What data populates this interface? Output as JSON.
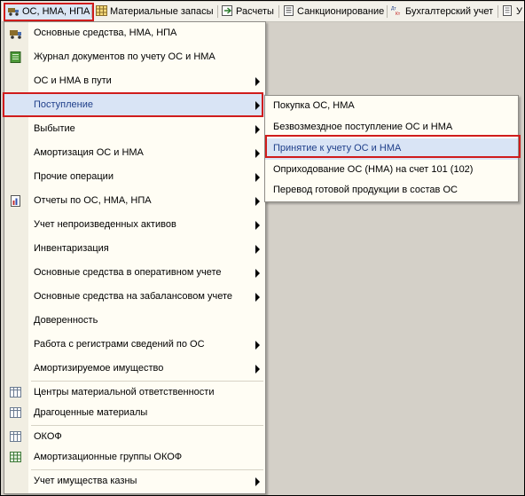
{
  "menubar": {
    "items": [
      {
        "label": "ОС, НМА, НПА",
        "icon": "truck-icon",
        "active": true
      },
      {
        "label": "Материальные запасы",
        "icon": "grid-icon"
      },
      {
        "label": "Расчеты",
        "icon": "calc-icon"
      },
      {
        "label": "Санкционирование",
        "icon": "doc-list-icon"
      },
      {
        "label": "Бухгалтерский учет",
        "icon": "dt-kt-icon"
      },
      {
        "label": "У",
        "icon": "report-icon"
      }
    ]
  },
  "main_menu": {
    "items": [
      {
        "label": "Основные средства, НМА, НПА",
        "icon": "truck-icon",
        "submenu": false
      },
      {
        "label": "Журнал документов по учету ОС и НМА",
        "icon": "journal-icon",
        "submenu": false
      },
      {
        "label": "ОС и НМА в пути",
        "submenu": true
      },
      {
        "label": "Поступление",
        "submenu": true,
        "highlighted": true
      },
      {
        "label": "Выбытие",
        "submenu": true
      },
      {
        "label": "Амортизация ОС и НМА",
        "submenu": true
      },
      {
        "label": "Прочие операции",
        "submenu": true
      },
      {
        "label": "Отчеты по ОС, НМА, НПА",
        "icon": "report-icon",
        "submenu": true
      },
      {
        "label": "Учет непроизведенных активов",
        "submenu": true
      },
      {
        "label": "Инвентаризация",
        "submenu": true
      },
      {
        "label": "Основные средства в оперативном учете",
        "submenu": true
      },
      {
        "label": "Основные средства на забалансовом учете",
        "submenu": true
      },
      {
        "label": "Доверенность",
        "submenu": false
      },
      {
        "label": "Работа с регистрами сведений по ОС",
        "submenu": true
      },
      {
        "label": "Амортизируемое имущество",
        "submenu": true
      },
      {
        "label": "Центры материальной ответственности",
        "icon": "table-icon",
        "submenu": false
      },
      {
        "label": "Драгоценные материалы",
        "icon": "table-icon",
        "submenu": false
      },
      {
        "label": "ОКОФ",
        "icon": "table-icon",
        "submenu": false
      },
      {
        "label": "Амортизационные группы ОКОФ",
        "icon": "grid-green-icon",
        "submenu": false
      },
      {
        "label": "Учет имущества казны",
        "submenu": true
      }
    ]
  },
  "sub_menu": {
    "items": [
      {
        "label": "Покупка ОС, НМА"
      },
      {
        "label": "Безвозмездное поступление ОС и НМА"
      },
      {
        "label": "Принятие к учету ОС и НМА",
        "highlighted": true
      },
      {
        "label": "Оприходование ОС (НМА) на счет 101 (102)"
      },
      {
        "label": "Перевод готовой продукции в состав ОС"
      }
    ]
  },
  "colors": {
    "highlight": "#d9e4f5",
    "annotation_red": "#d01c1c",
    "workspace": "#d4d0c8"
  }
}
